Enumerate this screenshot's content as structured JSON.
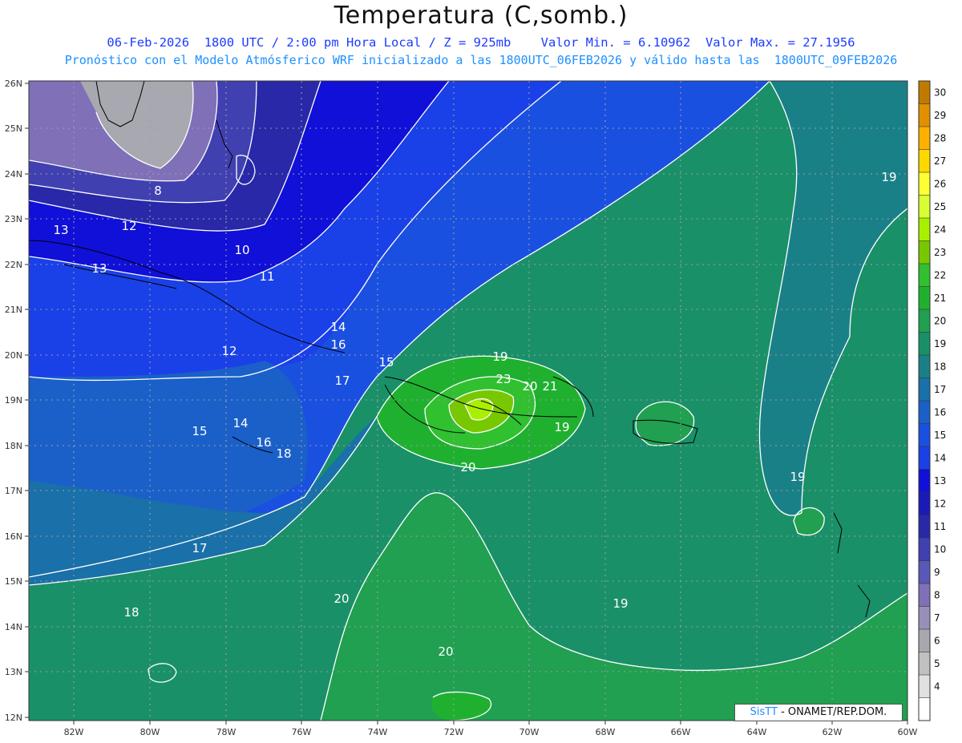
{
  "header": {
    "title": "Temperatura (C,somb.)",
    "line1": "06-Feb-2026  1800 UTC / 2:00 pm Hora Local / Z = 925mb    Valor Min. = 6.10962  Valor Max. = 27.1956",
    "line2": "Pronóstico con el Modelo Atmósferico WRF inicializado a las 1800UTC_06FEB2026 y válido hasta las  1800UTC_09FEB2026"
  },
  "map": {
    "lat_labels": [
      "26N",
      "25N",
      "24N",
      "23N",
      "22N",
      "21N",
      "20N",
      "19N",
      "18N",
      "17N",
      "16N",
      "15N",
      "14N",
      "13N",
      "12N"
    ],
    "lon_labels": [
      "82W",
      "80W",
      "78W",
      "76W",
      "74W",
      "72W",
      "70W",
      "68W",
      "66W",
      "64W",
      "62W",
      "60W"
    ],
    "contour_labels": [
      {
        "text": "8"
      },
      {
        "text": "10"
      },
      {
        "text": "11"
      },
      {
        "text": "12"
      },
      {
        "text": "13"
      },
      {
        "text": "13"
      },
      {
        "text": "12"
      },
      {
        "text": "14"
      },
      {
        "text": "16"
      },
      {
        "text": "15"
      },
      {
        "text": "17"
      },
      {
        "text": "15"
      },
      {
        "text": "14"
      },
      {
        "text": "16"
      },
      {
        "text": "18"
      },
      {
        "text": "19"
      },
      {
        "text": "23"
      },
      {
        "text": "20"
      },
      {
        "text": "21"
      },
      {
        "text": "19"
      },
      {
        "text": "20"
      },
      {
        "text": "19"
      },
      {
        "text": "17"
      },
      {
        "text": "20"
      },
      {
        "text": "18"
      },
      {
        "text": "19"
      },
      {
        "text": "20"
      },
      {
        "text": "19"
      }
    ]
  },
  "colorbar": {
    "labels": [
      "30",
      "29",
      "28",
      "27",
      "26",
      "25",
      "24",
      "23",
      "22",
      "21",
      "20",
      "19",
      "18",
      "17",
      "16",
      "15",
      "14",
      "13",
      "12",
      "11",
      "10",
      "9",
      "8",
      "7",
      "6",
      "5",
      "4"
    ],
    "colors": [
      "#c17a00",
      "#e09000",
      "#ffb000",
      "#ffd800",
      "#ffff33",
      "#d8ff33",
      "#a8f000",
      "#78c800",
      "#30c030",
      "#20b030",
      "#20a050",
      "#1a9068",
      "#1a8088",
      "#1a70a8",
      "#1a60c8",
      "#1a50e0",
      "#1a40e8",
      "#1010d8",
      "#1a1ab8",
      "#2828a8",
      "#4040b0",
      "#5858b8",
      "#8070b8",
      "#9890b8",
      "#a8a8b0",
      "#c0c0c0",
      "#e0e0e0",
      "#ffffff"
    ]
  },
  "credit": {
    "sis": "SisTT",
    "org": " - ONAMET/REP.DOM."
  }
}
